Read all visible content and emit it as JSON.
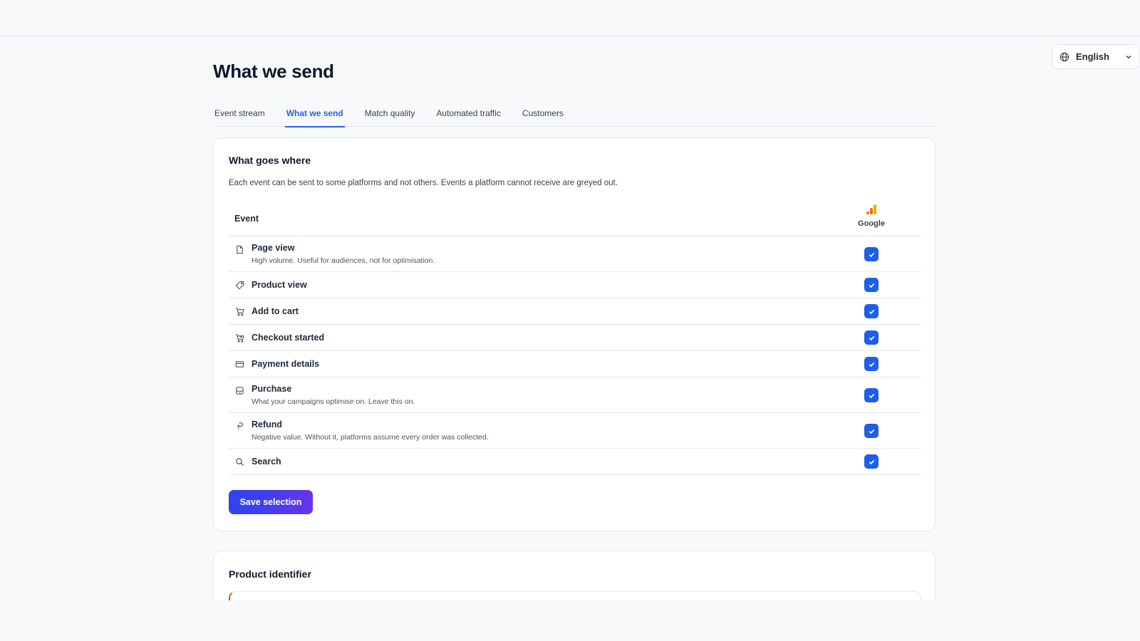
{
  "language": {
    "label": "English",
    "globe_icon": "globe-icon",
    "chevron_icon": "chevron-down-icon"
  },
  "page": {
    "title": "What we send"
  },
  "tabs": [
    {
      "label": "Event stream",
      "active": false
    },
    {
      "label": "What we send",
      "active": true
    },
    {
      "label": "Match quality",
      "active": false
    },
    {
      "label": "Automated traffic",
      "active": false
    },
    {
      "label": "Customers",
      "active": false
    }
  ],
  "what_goes_where": {
    "title": "What goes where",
    "description": "Each event can be sent to some platforms and not others. Events a platform cannot receive are greyed out.",
    "event_header": "Event",
    "platform": {
      "name": "Google",
      "icon": "google-analytics-icon"
    },
    "events": [
      {
        "name": "Page view",
        "description": "High volume. Useful for audiences, not for optimisation.",
        "icon": "page-icon",
        "checked": true
      },
      {
        "name": "Product view",
        "description": "",
        "icon": "tag-icon",
        "checked": true
      },
      {
        "name": "Add to cart",
        "description": "",
        "icon": "cart-icon",
        "checked": true
      },
      {
        "name": "Checkout started",
        "description": "",
        "icon": "cart-arrow-icon",
        "checked": true
      },
      {
        "name": "Payment details",
        "description": "",
        "icon": "credit-card-icon",
        "checked": true
      },
      {
        "name": "Purchase",
        "description": "What your campaigns optimise on. Leave this on.",
        "icon": "purchase-icon",
        "checked": true
      },
      {
        "name": "Refund",
        "description": "Negative value. Without it, platforms assume every order was collected.",
        "icon": "refund-icon",
        "checked": true
      },
      {
        "name": "Search",
        "description": "",
        "icon": "search-icon",
        "checked": true
      }
    ],
    "save_label": "Save selection"
  },
  "product_identifier": {
    "title": "Product identifier"
  },
  "colors": {
    "accent": "#2563eb",
    "checkbox": "#1d5eea",
    "button_start": "#2f43f0",
    "button_end": "#6b33e6",
    "google_orange": "#f9ab00",
    "google_dark_orange": "#e37400"
  }
}
